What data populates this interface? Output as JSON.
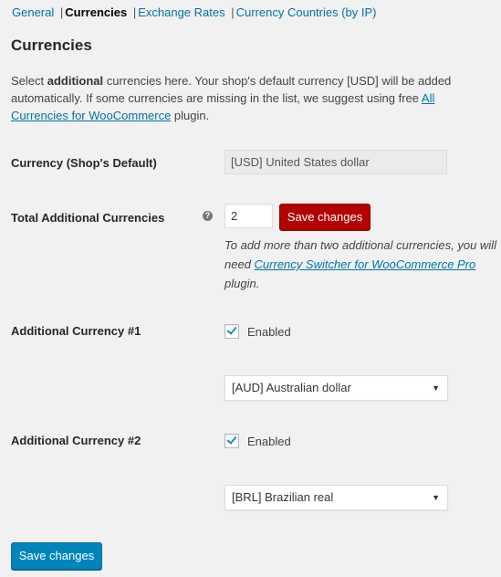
{
  "subnav": {
    "items": [
      {
        "label": "General",
        "current": false
      },
      {
        "label": "Currencies",
        "current": true
      },
      {
        "label": "Exchange Rates",
        "current": false
      },
      {
        "label": "Currency Countries (by IP)",
        "current": false
      }
    ],
    "separator": "|"
  },
  "page_title": "Currencies",
  "intro": {
    "part1": "Select ",
    "bold": "additional",
    "part2": " currencies here. Your shop's default currency [USD] will be added automatically. If some currencies are missing in the list, we suggest using free ",
    "link": "All Currencies for WooCommerce",
    "part3": " plugin."
  },
  "fields": {
    "default_currency": {
      "label": "Currency (Shop's Default)",
      "value": "[USD] United States dollar"
    },
    "total_additional": {
      "label": "Total Additional Currencies",
      "help_icon": "question-circle-icon",
      "value": "2",
      "save_label": "Save changes",
      "desc_part1": "To add more than two additional currencies, you will need ",
      "desc_link": "Currency Switcher for WooCommerce Pro",
      "desc_part2": " plugin."
    },
    "additional": [
      {
        "label": "Additional Currency #1",
        "enabled": true,
        "enabled_label": "Enabled",
        "selected": "[AUD] Australian dollar"
      },
      {
        "label": "Additional Currency #2",
        "enabled": true,
        "enabled_label": "Enabled",
        "selected": "[BRL] Brazilian real"
      }
    ]
  },
  "footer": {
    "save_label": "Save changes"
  },
  "colors": {
    "link": "#0073aa",
    "primary_button": "#0085ba",
    "danger_button": "#b30000",
    "background": "#f1f1f1"
  }
}
